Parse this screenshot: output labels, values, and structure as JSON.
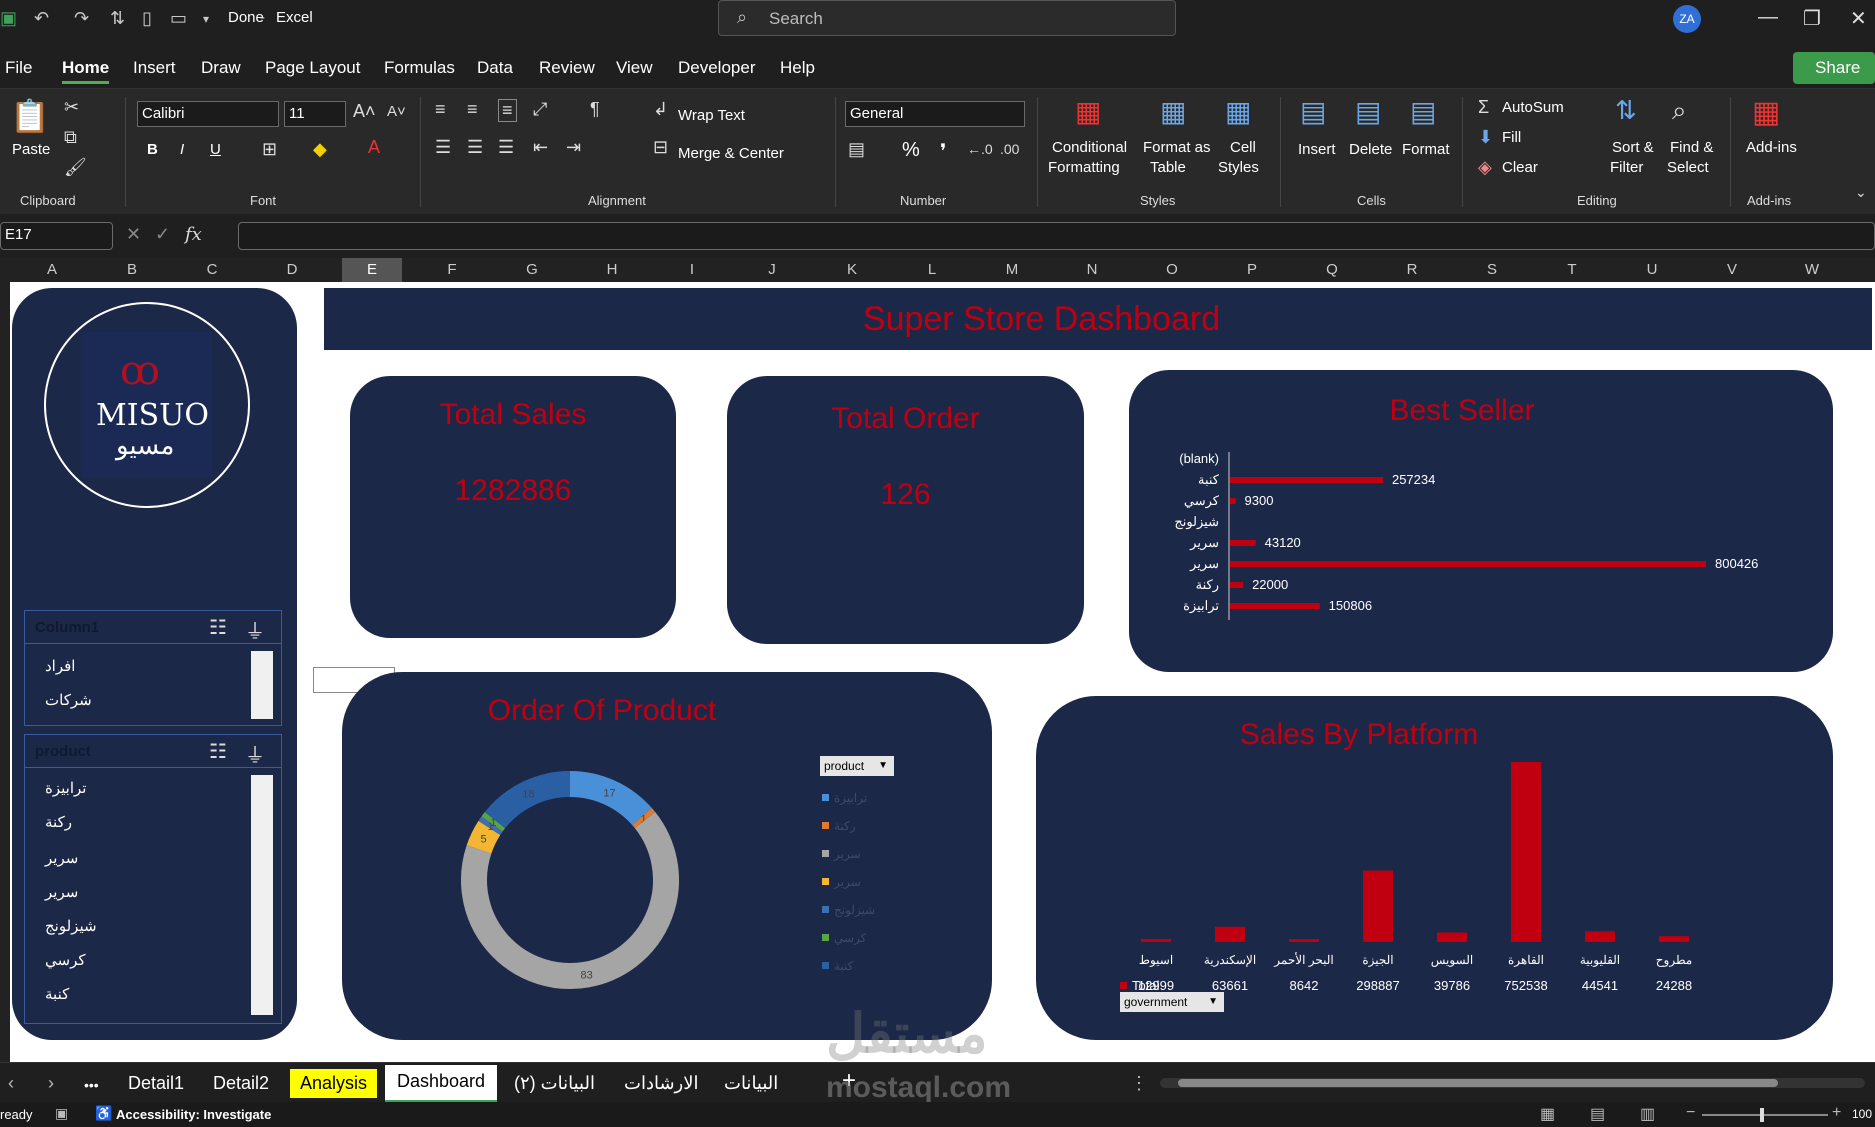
{
  "titlebar": {
    "doc_name": "Done",
    "app_name": "Excel",
    "search_placeholder": "Search",
    "user_initials": "ZA"
  },
  "menu": {
    "items": [
      "File",
      "Home",
      "Insert",
      "Draw",
      "Page Layout",
      "Formulas",
      "Data",
      "Review",
      "View",
      "Developer",
      "Help"
    ],
    "active": "Home",
    "share": "Share"
  },
  "ribbon": {
    "paste": "Paste",
    "clipboard": "Clipboard",
    "font_name": "Calibri",
    "font_size": "11",
    "font_group": "Font",
    "bold": "B",
    "italic": "I",
    "underline": "U",
    "wrap_text": "Wrap Text",
    "merge_center": "Merge & Center",
    "alignment_group": "Alignment",
    "number_format": "General",
    "percent": "%",
    "comma": "❜",
    "number_group": "Number",
    "conditional_1": "Conditional",
    "conditional_2": "Formatting",
    "format_table_1": "Format as",
    "format_table_2": "Table",
    "cell_styles_1": "Cell",
    "cell_styles_2": "Styles",
    "styles_group": "Styles",
    "insert": "Insert",
    "delete": "Delete",
    "format": "Format",
    "cells_group": "Cells",
    "autosum": "AutoSum",
    "fill": "Fill",
    "clear": "Clear",
    "sort_1": "Sort &",
    "sort_2": "Filter",
    "find_1": "Find &",
    "find_2": "Select",
    "editing_group": "Editing",
    "addins": "Add-ins",
    "addins_group": "Add-ins"
  },
  "formula_bar": {
    "name_box": "E17",
    "fx": "fx",
    "cancel": "✕",
    "enter": "✓"
  },
  "columns": [
    "A",
    "B",
    "C",
    "D",
    "E",
    "F",
    "G",
    "H",
    "I",
    "J",
    "K",
    "L",
    "M",
    "N",
    "O",
    "P",
    "Q",
    "R",
    "S",
    "T",
    "U",
    "V",
    "W"
  ],
  "dashboard": {
    "title": "Super Store Dashboard",
    "logo_text": "MISUO",
    "logo_arabic": "مسيو",
    "total_sales": {
      "title": "Total Sales",
      "value": "1282886"
    },
    "total_order": {
      "title": "Total Order",
      "value": "126"
    },
    "best_seller": {
      "title": "Best Seller"
    },
    "order_of_product": {
      "title": "Order Of Product",
      "legend_button": "product"
    },
    "sales_by_platform": {
      "title": "Sales By Platform",
      "legend_total": "Total",
      "filter_button": "government"
    }
  },
  "slicers": {
    "column1": {
      "header": "Column1",
      "items": [
        "افراد",
        "شركات"
      ]
    },
    "product": {
      "header": "product",
      "items": [
        "ترابيزة",
        "ركنة",
        "سرير",
        "سرير",
        "شيزلونج",
        "كرسي",
        "كنبة"
      ]
    }
  },
  "chart_data": [
    {
      "type": "bar",
      "orientation": "horizontal",
      "title": "Best Seller",
      "categories": [
        "(blank)",
        "كنبة",
        "كرسي",
        "شيزلونج",
        "سرير",
        "سرير",
        "ركنة",
        "ترابيزة"
      ],
      "values": [
        0,
        257234,
        9300,
        0,
        43120,
        800426,
        22000,
        150806
      ],
      "labels": [
        "",
        "257234",
        "9300",
        "",
        "43120",
        "800426",
        "22000",
        "150806"
      ],
      "color": "#c00010"
    },
    {
      "type": "pie",
      "subtype": "doughnut",
      "title": "Order Of Product",
      "categories": [
        "ترابيزة",
        "ركنة",
        "سرير",
        "سرير",
        "شيزلونج",
        "كرسي",
        "كنبة"
      ],
      "values": [
        17,
        1,
        83,
        5,
        1,
        1,
        18
      ],
      "colors": [
        "#4a90d9",
        "#e07a2e",
        "#a5a5a5",
        "#f2b632",
        "#3d6fb5",
        "#5aa447",
        "#2b5fa3"
      ],
      "legend": "right"
    },
    {
      "type": "bar",
      "title": "Sales By Platform",
      "categories": [
        "اسيوط",
        "الإسكندرية",
        "البحر الأحمر",
        "الجيزة",
        "السويس",
        "القاهرة",
        "القليوبية",
        "مطروح"
      ],
      "values": [
        12999,
        63661,
        8642,
        298887,
        39786,
        752538,
        44541,
        24288
      ],
      "series": [
        {
          "name": "Total",
          "values": [
            12999,
            63661,
            8642,
            298887,
            39786,
            752538,
            44541,
            24288
          ]
        }
      ],
      "color": "#c00010"
    }
  ],
  "tabs": {
    "items": [
      "Detail1",
      "Detail2",
      "Analysis",
      "Dashboard",
      "البيانات (٢)",
      "الارشادات",
      "البيانات"
    ],
    "active": "Dashboard",
    "highlight": "Analysis",
    "more": "•••"
  },
  "status": {
    "ready": "ready",
    "accessibility": "Accessibility: Investigate",
    "zoom": "100"
  },
  "watermark": {
    "arabic": "مستقل",
    "latin": "mostaql.com"
  }
}
